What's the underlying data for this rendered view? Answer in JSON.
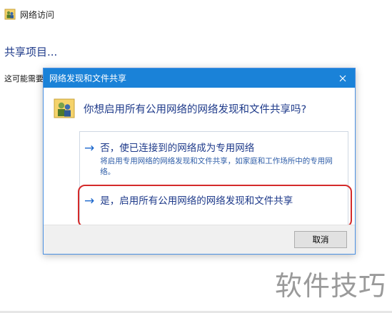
{
  "background_window": {
    "title": "网络访问",
    "title_icon": "network-users-icon",
    "heading": "共享项目...",
    "description": "这可能需要"
  },
  "dialog": {
    "title": "网络发现和文件共享",
    "close_icon": "close-icon",
    "question": "你想启用所有公用网络的网络发现和文件共享吗?",
    "question_icon": "network-users-icon",
    "options": [
      {
        "label": "否，使已连接到的网络成为专用网络",
        "sub": "将启用专用网络的网络发现和文件共享，如家庭和工作场所中的专用网络。",
        "icon": "arrow-right-icon"
      },
      {
        "label": "是，启用所有公用网络的网络发现和文件共享",
        "icon": "arrow-right-icon"
      }
    ],
    "cancel_label": "取消",
    "accent_color": "#1a82d8",
    "highlight_color": "#d42a2a"
  },
  "watermark": "软件技巧"
}
